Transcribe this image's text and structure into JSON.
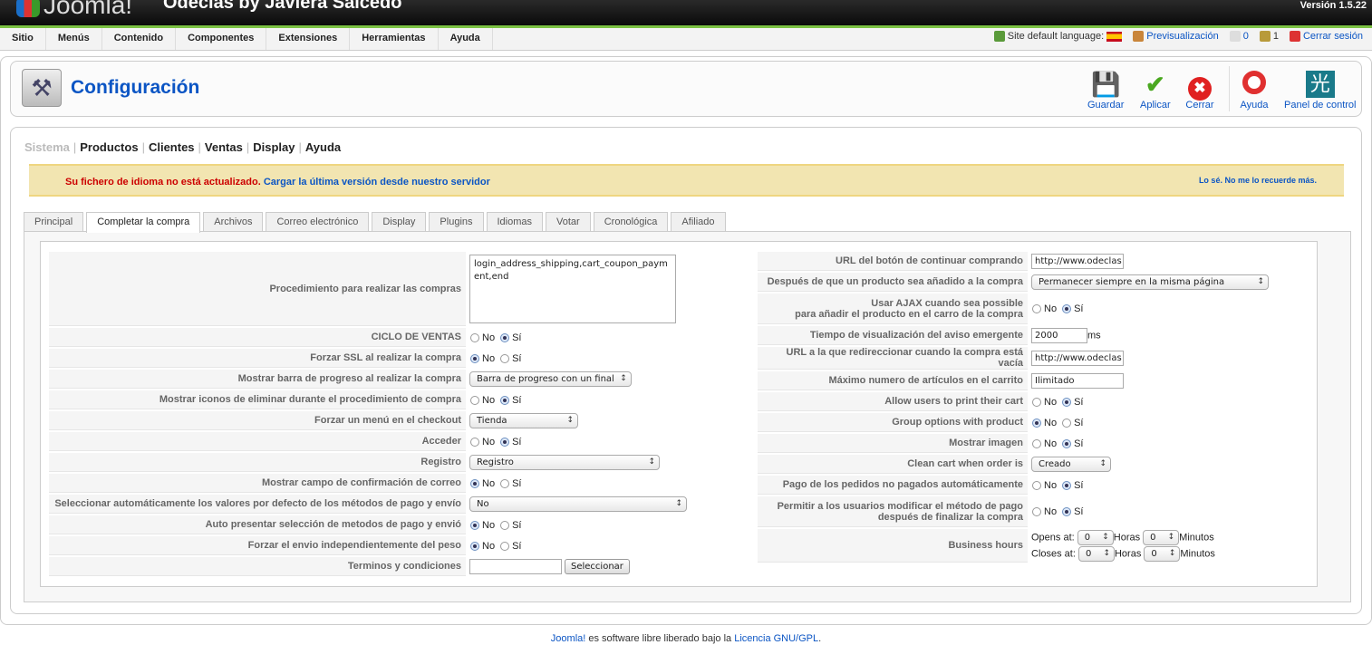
{
  "header": {
    "logo": "Joomla!",
    "site_name": "Odeclas by Javiera Salcedo",
    "version": "Versión 1.5.22"
  },
  "menu": [
    "Sitio",
    "Menús",
    "Contenido",
    "Componentes",
    "Extensiones",
    "Herramientas",
    "Ayuda"
  ],
  "status": {
    "language_label": "Site default language:",
    "preview": "Previsualización",
    "messages": "0",
    "users": "1",
    "logout": "Cerrar sesión"
  },
  "toolbar": {
    "title": "Configuración",
    "save": "Guardar",
    "apply": "Aplicar",
    "close": "Cerrar",
    "help": "Ayuda",
    "control_panel": "Panel de control"
  },
  "subnav": [
    "Sistema",
    "Productos",
    "Clientes",
    "Ventas",
    "Display",
    "Ayuda"
  ],
  "notice": {
    "message": "Su fichero de idioma no está actualizado.",
    "link": "Cargar la última versión desde nuestro servidor",
    "dismiss": "Lo sé. No me lo recuerde más."
  },
  "tabs": [
    "Principal",
    "Completar la compra",
    "Archivos",
    "Correo electrónico",
    "Display",
    "Plugins",
    "Idiomas",
    "Votar",
    "Cronológica",
    "Afiliado"
  ],
  "radio": {
    "no": "No",
    "yes": "Sí"
  },
  "left_rows": [
    {
      "label": "Procedimiento para realizar las compras",
      "type": "textarea",
      "value": "login_address_shipping,cart_coupon_payment,end"
    },
    {
      "label": "CICLO DE VENTAS",
      "type": "radio",
      "value": "yes"
    },
    {
      "label": "Forzar SSL al realizar la compra",
      "type": "radio",
      "value": "no"
    },
    {
      "label": "Mostrar barra de progreso al realizar la compra",
      "type": "select",
      "value": "Barra de progreso con un final",
      "w": 178
    },
    {
      "label": "Mostrar iconos de eliminar durante el procedimiento de compra",
      "type": "radio",
      "value": "yes"
    },
    {
      "label": "Forzar un menú en el checkout",
      "type": "select",
      "value": "Tienda",
      "w": 120
    },
    {
      "label": "Acceder",
      "type": "radio",
      "value": "yes"
    },
    {
      "label": "Registro",
      "type": "select",
      "value": "Registro",
      "w": 210
    },
    {
      "label": "Mostrar campo de confirmación de correo",
      "type": "radio",
      "value": "no"
    },
    {
      "label": "Seleccionar automáticamente los valores por defecto de los métodos de pago y envío",
      "type": "select",
      "value": "No",
      "w": 240
    },
    {
      "label": "Auto presentar selección de metodos de pago y envió",
      "type": "radio",
      "value": "no"
    },
    {
      "label": "Forzar el envio independientemente del peso",
      "type": "radio",
      "value": "no"
    },
    {
      "label": "Terminos y condiciones",
      "type": "file",
      "value": "",
      "button": "Seleccionar"
    }
  ],
  "right_rows": [
    {
      "label": "URL del botón de continuar comprando",
      "type": "text",
      "value": "http://www.odeclas",
      "w": 102
    },
    {
      "label": "Después de que un producto sea añadido a la compra",
      "type": "select",
      "value": "Permanecer siempre en la misma página",
      "w": 262
    },
    {
      "label": "Usar AJAX cuando sea possible\npara añadir el producto en el carro de la compra",
      "type": "radio",
      "value": "yes"
    },
    {
      "label": "Tiempo de visualización del aviso emergente",
      "type": "text",
      "value": "2000",
      "w": 62,
      "suffix": "ms"
    },
    {
      "label": "URL a la que redireccionar cuando la compra está vacía",
      "type": "text",
      "value": "http://www.odeclas",
      "w": 102
    },
    {
      "label": "Máximo numero de artículos en el carrito",
      "type": "text",
      "value": "Ilimitado",
      "w": 102
    },
    {
      "label": "Allow users to print their cart",
      "type": "radio",
      "value": "yes"
    },
    {
      "label": "Group options with product",
      "type": "radio",
      "value": "no"
    },
    {
      "label": "Mostrar imagen",
      "type": "radio",
      "value": "yes"
    },
    {
      "label": "Clean cart when order is",
      "type": "select",
      "value": "Creado",
      "w": 88
    },
    {
      "label": "Pago de los pedidos no pagados automáticamente",
      "type": "radio",
      "value": "yes"
    },
    {
      "label": "Permitir a los usuarios modificar el método de pago\ndespués de finalizar la compra",
      "type": "radio",
      "value": "yes"
    },
    {
      "label": "Business hours",
      "type": "hours",
      "opens": "Opens at:",
      "closes": "Closes at:",
      "hours": "Horas",
      "minutes": "Minutos",
      "open_h": "0",
      "open_m": "0",
      "close_h": "0",
      "close_m": "0"
    }
  ],
  "footer": {
    "brand": "Joomla!",
    "text": " es software libre liberado bajo la ",
    "license": "Licencia GNU/GPL",
    "end": "."
  }
}
